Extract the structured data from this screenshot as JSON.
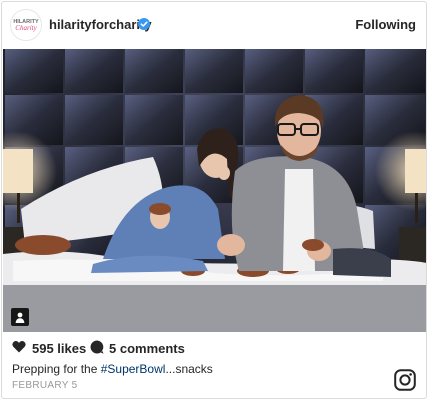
{
  "header": {
    "username": "hilarityforcharity",
    "avatar_text": "HILARITY for CHARITY",
    "follow_label": "Following"
  },
  "photo": {
    "icon": "user-tag-icon"
  },
  "actions": {
    "likes_text": "595 likes",
    "comments_text": "5 comments",
    "like_icon": "heart-icon",
    "comment_icon": "comment-bubble-icon"
  },
  "caption": {
    "before": "Prepping for the ",
    "hashtag": "#SuperBowl",
    "after": "...snacks"
  },
  "date": "FEBRUARY 5",
  "colors": {
    "verified_blue": "#3897f0",
    "hashtag": "#003569",
    "text": "#262626",
    "muted": "#999999",
    "border": "#dbdbdb"
  }
}
